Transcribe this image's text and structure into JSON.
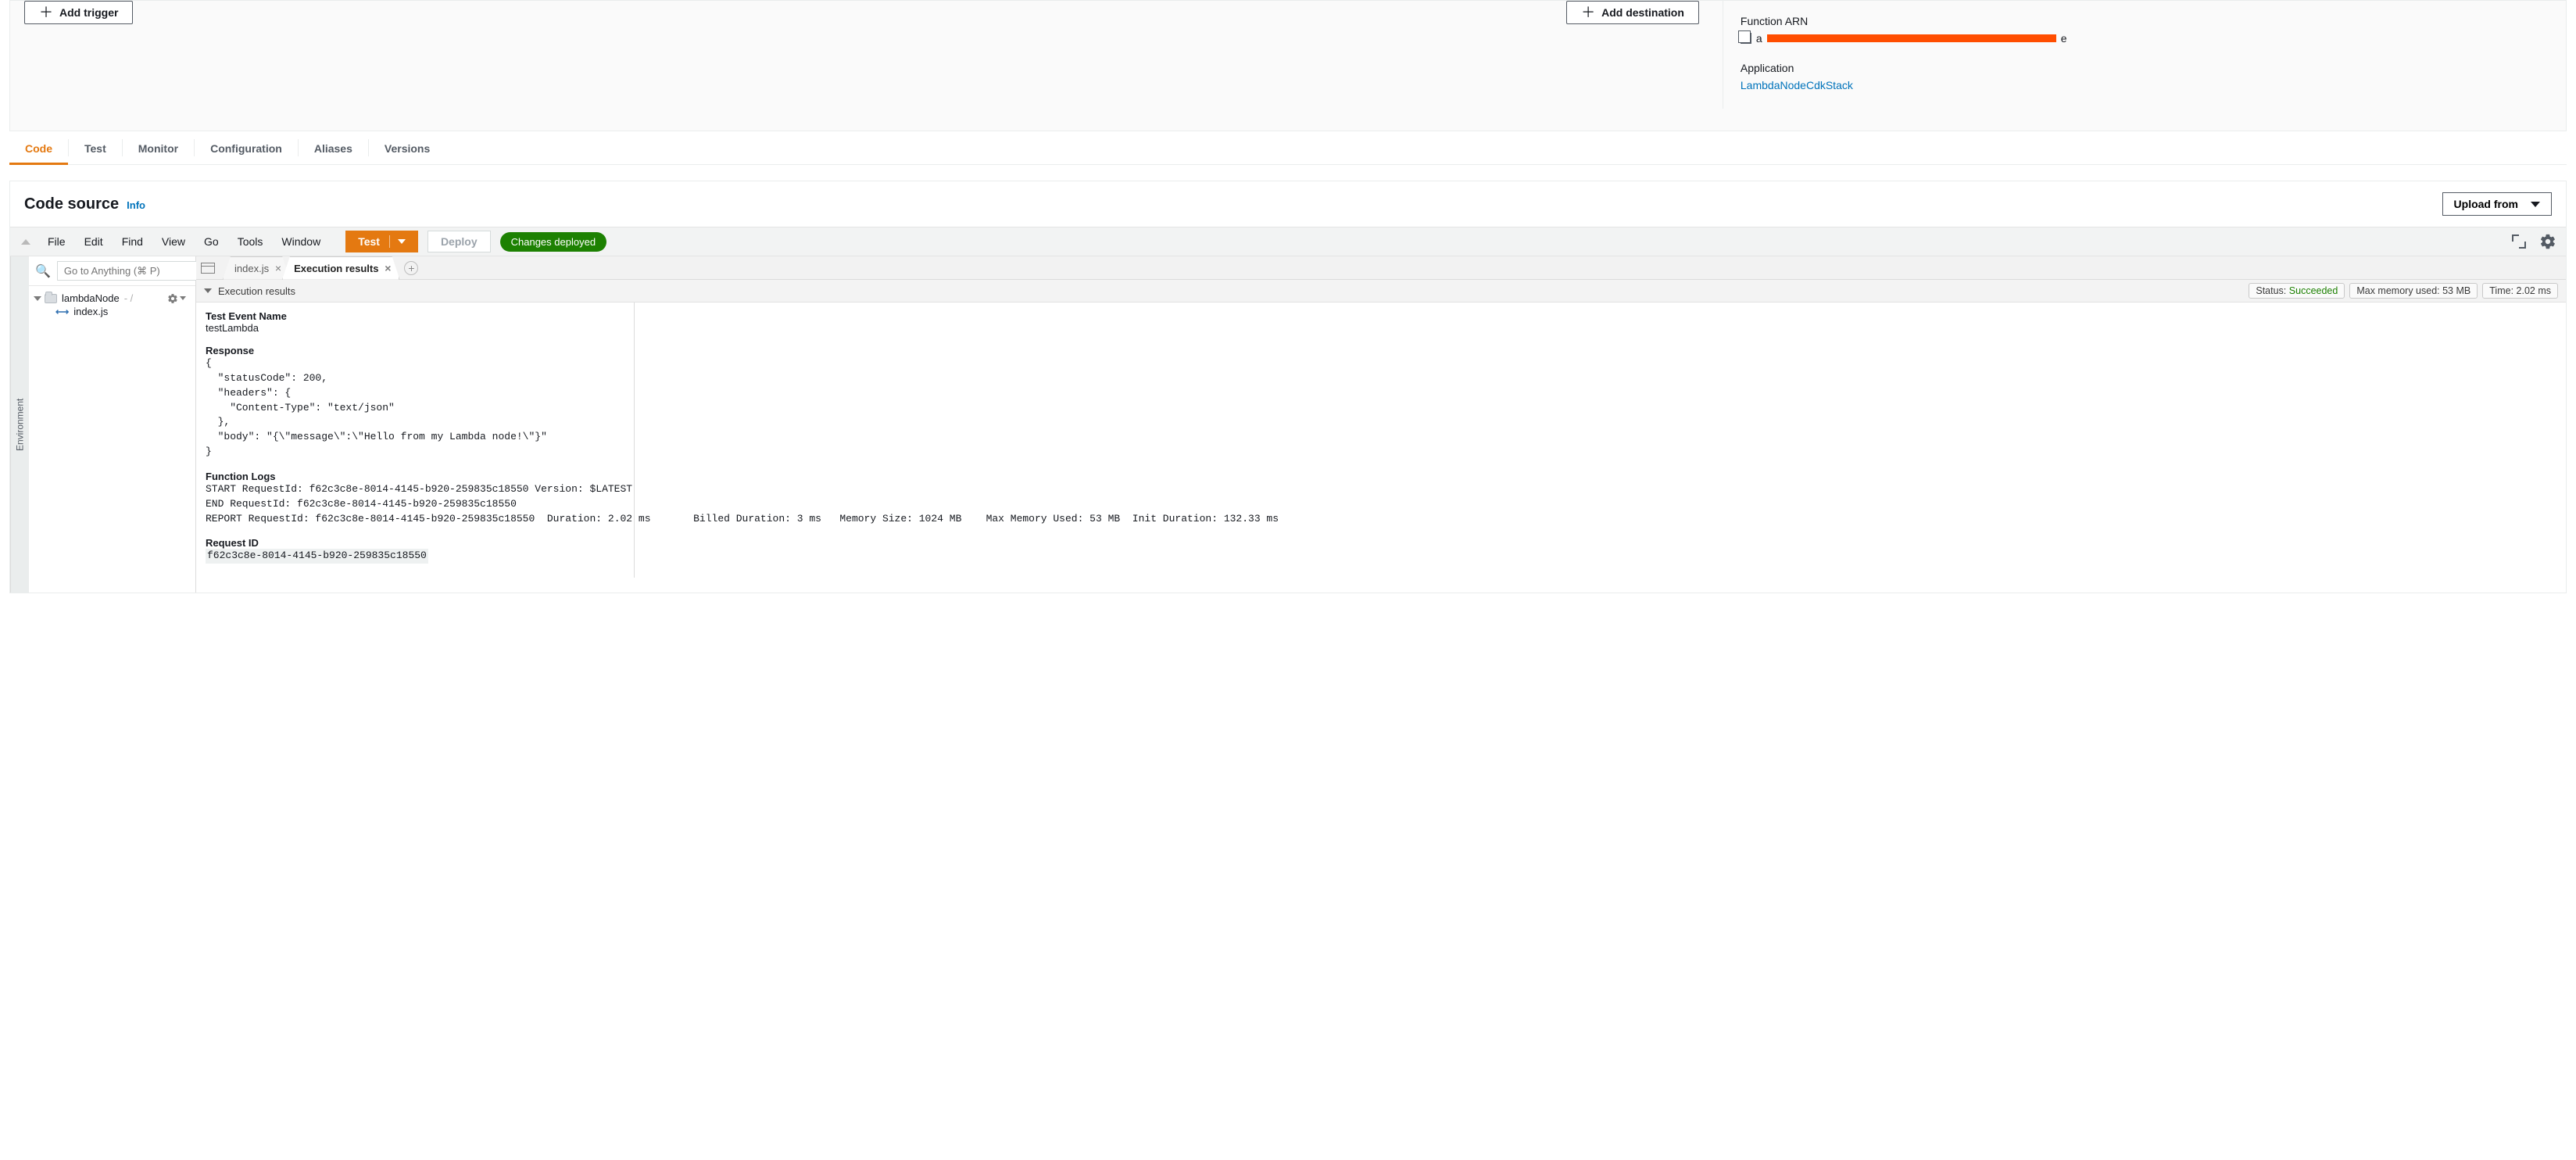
{
  "designer": {
    "add_trigger": "Add trigger",
    "add_destination": "Add destination",
    "arn_label": "Function ARN",
    "arn_prefix": "a",
    "arn_suffix": "e",
    "application_label": "Application",
    "application_name": "LambdaNodeCdkStack"
  },
  "tabs": {
    "items": [
      "Code",
      "Test",
      "Monitor",
      "Configuration",
      "Aliases",
      "Versions"
    ],
    "active_index": 0
  },
  "code_source": {
    "title": "Code source",
    "info": "Info",
    "upload_from": "Upload from"
  },
  "ide_menu": {
    "items": [
      "File",
      "Edit",
      "Find",
      "View",
      "Go",
      "Tools",
      "Window"
    ],
    "test": "Test",
    "deploy": "Deploy",
    "deployed_badge": "Changes deployed"
  },
  "env_rail": "Environment",
  "goto_placeholder": "Go to Anything (⌘ P)",
  "tree": {
    "root": "lambdaNode",
    "child": "index.js"
  },
  "editor_tabs": {
    "tab1": "index.js",
    "tab2": "Execution results"
  },
  "exec_header": {
    "title": "Execution results",
    "status_label": "Status:",
    "status_value": "Succeeded",
    "mem_label": "Max memory used:",
    "mem_value": "53 MB",
    "time_label": "Time:",
    "time_value": "2.02 ms"
  },
  "results": {
    "test_event_name_label": "Test Event Name",
    "test_event_name": "testLambda",
    "response_label": "Response",
    "response_body": "{\n  \"statusCode\": 200,\n  \"headers\": {\n    \"Content-Type\": \"text/json\"\n  },\n  \"body\": \"{\\\"message\\\":\\\"Hello from my Lambda node!\\\"}\"\n}",
    "logs_label": "Function Logs",
    "logs_body": "START RequestId: f62c3c8e-8014-4145-b920-259835c18550 Version: $LATEST\nEND RequestId: f62c3c8e-8014-4145-b920-259835c18550\nREPORT RequestId: f62c3c8e-8014-4145-b920-259835c18550\tDuration: 2.02 ms\tBilled Duration: 3 ms\tMemory Size: 1024 MB\tMax Memory Used: 53 MB\tInit Duration: 132.33 ms",
    "request_id_label": "Request ID",
    "request_id": "f62c3c8e-8014-4145-b920-259835c18550"
  }
}
